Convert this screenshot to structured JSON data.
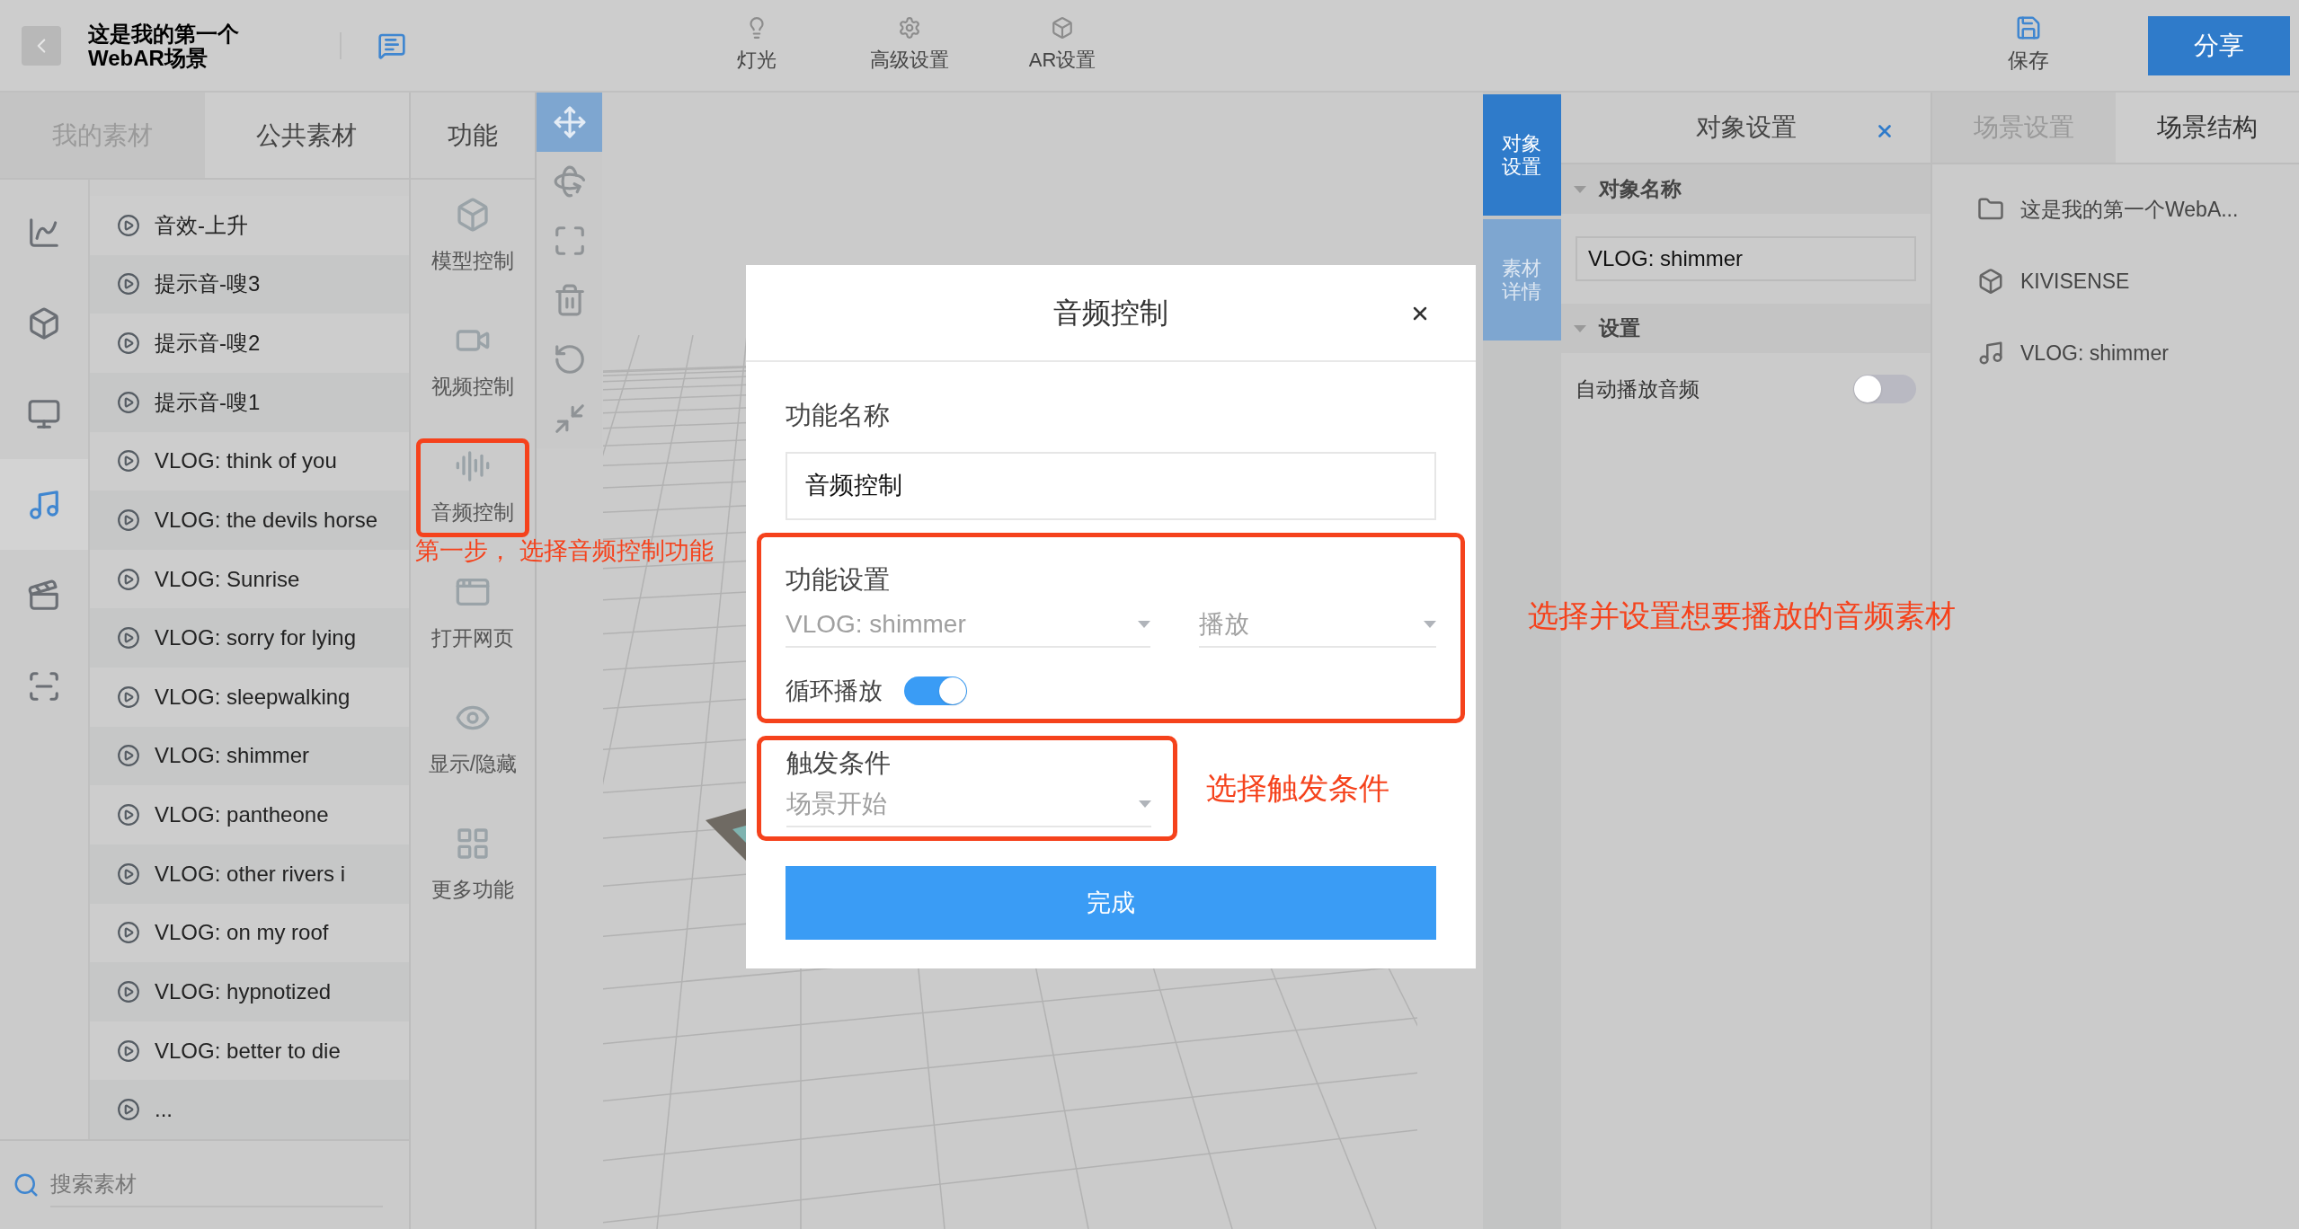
{
  "header": {
    "title_lines": [
      "这是我的第一个",
      "WebAR场景"
    ],
    "toolbar": [
      {
        "label": "灯光",
        "kind": "bulb"
      },
      {
        "label": "高级设置",
        "kind": "gear"
      },
      {
        "label": "AR设置",
        "kind": "cube"
      }
    ],
    "save": "保存",
    "share": "分享"
  },
  "left_tabs": [
    {
      "label": "我的素材",
      "selected": false
    },
    {
      "label": "公共素材",
      "selected": true
    }
  ],
  "category_icons": [
    {
      "kind": "chart",
      "selected": false
    },
    {
      "kind": "cube",
      "selected": false
    },
    {
      "kind": "screen",
      "selected": false
    },
    {
      "kind": "music",
      "selected": true
    },
    {
      "kind": "film",
      "selected": false
    },
    {
      "kind": "frame",
      "selected": false
    }
  ],
  "assets": [
    "音效-上升",
    "提示音-嗖3",
    "提示音-嗖2",
    "提示音-嗖1",
    "VLOG: think of you",
    "VLOG: the devils horse",
    "VLOG: Sunrise",
    "VLOG: sorry for lying",
    "VLOG: sleepwalking",
    "VLOG: shimmer",
    "VLOG: pantheone",
    "VLOG: other rivers i",
    "VLOG: on my roof",
    "VLOG: hypnotized",
    "VLOG: better to die",
    "..."
  ],
  "search": {
    "placeholder": "搜索素材"
  },
  "function_tab": "功能",
  "functions": [
    {
      "label": "模型控制",
      "kind": "cube",
      "highlighted": false
    },
    {
      "label": "视频控制",
      "kind": "video",
      "highlighted": false
    },
    {
      "label": "音频控制",
      "kind": "audio",
      "highlighted": true
    },
    {
      "label": "打开网页",
      "kind": "web",
      "highlighted": false
    },
    {
      "label": "显示/隐藏",
      "kind": "eye",
      "highlighted": false
    },
    {
      "label": "更多功能",
      "kind": "grid",
      "highlighted": false
    }
  ],
  "tools": [
    {
      "kind": "move",
      "selected": true
    },
    {
      "kind": "rotate",
      "selected": false
    },
    {
      "kind": "scale",
      "selected": false
    },
    {
      "kind": "delete",
      "selected": false
    },
    {
      "kind": "undo",
      "selected": false
    },
    {
      "kind": "shrink",
      "selected": false
    }
  ],
  "side_tabs": [
    {
      "label": "对象设置",
      "selected": true
    },
    {
      "label": "素材详情",
      "selected": false
    }
  ],
  "object_panel": {
    "title": "对象设置",
    "sections": [
      {
        "title": "对象名称",
        "kind": "input",
        "value": "VLOG: shimmer"
      },
      {
        "title": "设置",
        "kind": "toggle",
        "label": "自动播放音频",
        "on": false
      }
    ]
  },
  "scene_tabs": [
    {
      "label": "场景设置",
      "selected": false
    },
    {
      "label": "场景结构",
      "selected": true
    }
  ],
  "scene_tree": [
    {
      "label": "这是我的第一个WebA...",
      "kind": "folder"
    },
    {
      "label": "KIVISENSE",
      "kind": "model"
    },
    {
      "label": "VLOG: shimmer",
      "kind": "audio"
    }
  ],
  "dialog": {
    "title": "音频控制",
    "name_label": "功能名称",
    "name_value": "音频控制",
    "settings_label": "功能设置",
    "audio_select": "VLOG: shimmer",
    "action_select": "播放",
    "loop_label": "循环播放",
    "loop_on": true,
    "trigger_label": "触发条件",
    "trigger_select": "场景开始",
    "done": "完成"
  },
  "annotations": [
    "第一步， 选择音频控制功能",
    "选择并设置想要播放的音频素材",
    "选择触发条件"
  ]
}
